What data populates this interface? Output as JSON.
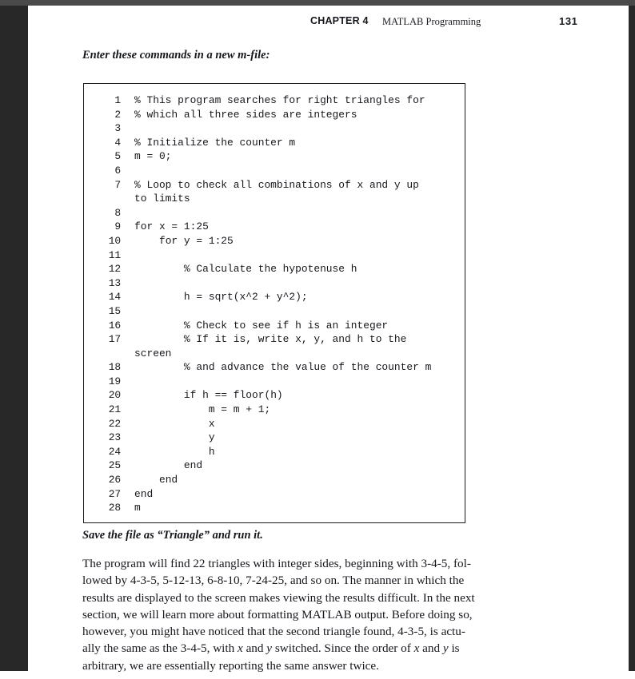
{
  "page": {
    "running_head": {
      "chapter_label": "CHAPTER 4",
      "chapter_title": "MATLAB Programming",
      "page_number": "131"
    },
    "lead_in": "Enter these commands in a new m-file:",
    "caption": "Save the file as “Triangle” and run it.",
    "code_listing": [
      {
        "number": "1",
        "text": "% This program searches for right triangles for"
      },
      {
        "number": "2",
        "text": "% which all three sides are integers"
      },
      {
        "number": "3",
        "text": ""
      },
      {
        "number": "4",
        "text": "% Initialize the counter m"
      },
      {
        "number": "5",
        "text": "m = 0;"
      },
      {
        "number": "6",
        "text": ""
      },
      {
        "number": "7",
        "text": "% Loop to check all combinations of x and y up",
        "continuation": "to limits"
      },
      {
        "number": "8",
        "text": ""
      },
      {
        "number": "9",
        "text": "for x = 1:25"
      },
      {
        "number": "10",
        "text": "    for y = 1:25"
      },
      {
        "number": "11",
        "text": ""
      },
      {
        "number": "12",
        "text": "        % Calculate the hypotenuse h"
      },
      {
        "number": "13",
        "text": ""
      },
      {
        "number": "14",
        "text": "        h = sqrt(x^2 + y^2);"
      },
      {
        "number": "15",
        "text": ""
      },
      {
        "number": "16",
        "text": "        % Check to see if h is an integer"
      },
      {
        "number": "17",
        "text": "        % If it is, write x, y, and h to the",
        "continuation": "screen"
      },
      {
        "number": "18",
        "text": "        % and advance the value of the counter m"
      },
      {
        "number": "19",
        "text": ""
      },
      {
        "number": "20",
        "text": "        if h == floor(h)"
      },
      {
        "number": "21",
        "text": "            m = m + 1;"
      },
      {
        "number": "22",
        "text": "            x"
      },
      {
        "number": "23",
        "text": "            y"
      },
      {
        "number": "24",
        "text": "            h"
      },
      {
        "number": "25",
        "text": "        end"
      },
      {
        "number": "26",
        "text": "    end"
      },
      {
        "number": "27",
        "text": "end"
      },
      {
        "number": "28",
        "text": "m"
      }
    ],
    "body_paragraph_lines": [
      [
        {
          "t": "The program will find 22 triangles with integer sides, beginning with 3-4-5, fol-"
        }
      ],
      [
        {
          "t": "lowed by 4-3-5, 5-12-13, 6-8-10, 7-24-25, and so on. The manner in which the"
        }
      ],
      [
        {
          "t": "results are displayed to the screen makes viewing the results difficult. In the next"
        }
      ],
      [
        {
          "t": "section, we will learn more about formatting MATLAB output. Before doing so,"
        }
      ],
      [
        {
          "t": "however, you might have noticed that the second triangle found, 4-3-5, is actu-"
        }
      ],
      [
        {
          "t": "ally the same as the 3-4-5, with "
        },
        {
          "t": "x",
          "i": true
        },
        {
          "t": " and "
        },
        {
          "t": "y",
          "i": true
        },
        {
          "t": " switched. Since the order of "
        },
        {
          "t": "x",
          "i": true
        },
        {
          "t": " and "
        },
        {
          "t": "y",
          "i": true
        },
        {
          "t": " is"
        }
      ],
      [
        {
          "t": "arbitrary, we are essentially reporting the same answer twice."
        }
      ]
    ]
  },
  "colors": {
    "chrome_top_bar": "#4a4a4a",
    "chrome_gutter": "#282828",
    "page_background": "#ffffff",
    "text": "#16181d",
    "code_box_border": "#1a1a1a"
  }
}
